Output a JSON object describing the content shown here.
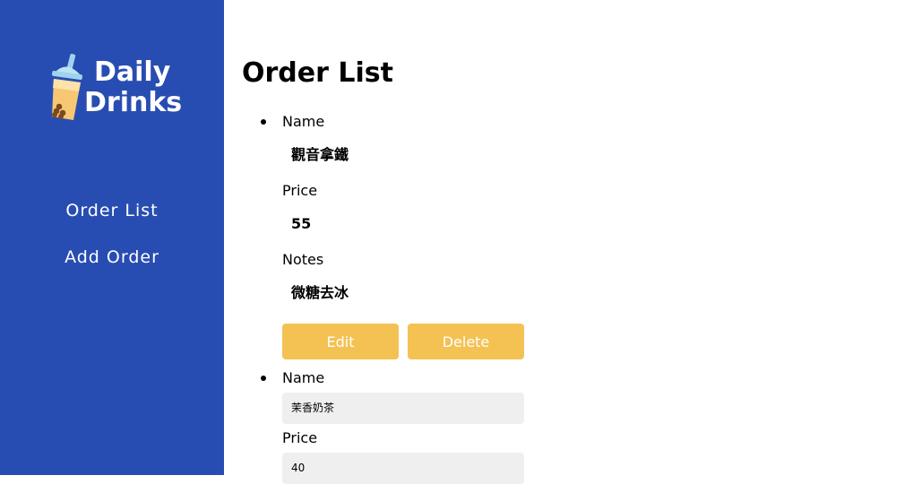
{
  "brand": {
    "line1": "Daily",
    "line2": "Drinks",
    "icon": "bubble-tea-icon",
    "colors": {
      "sidebar": "#284db2",
      "accent": "#f4c153",
      "input_bg": "#efefef"
    }
  },
  "nav": {
    "items": [
      {
        "label": "Order List"
      },
      {
        "label": "Add Order"
      }
    ]
  },
  "main": {
    "title": "Order List",
    "orders": [
      {
        "name_label": "Name",
        "name": "觀音拿鐵",
        "price_label": "Price",
        "price": "55",
        "notes_label": "Notes",
        "notes": "微糖去冰",
        "edit_label": "Edit",
        "delete_label": "Delete"
      },
      {
        "name_label": "Name",
        "name": "茉香奶茶",
        "price_label": "Price",
        "price": "40"
      }
    ]
  }
}
